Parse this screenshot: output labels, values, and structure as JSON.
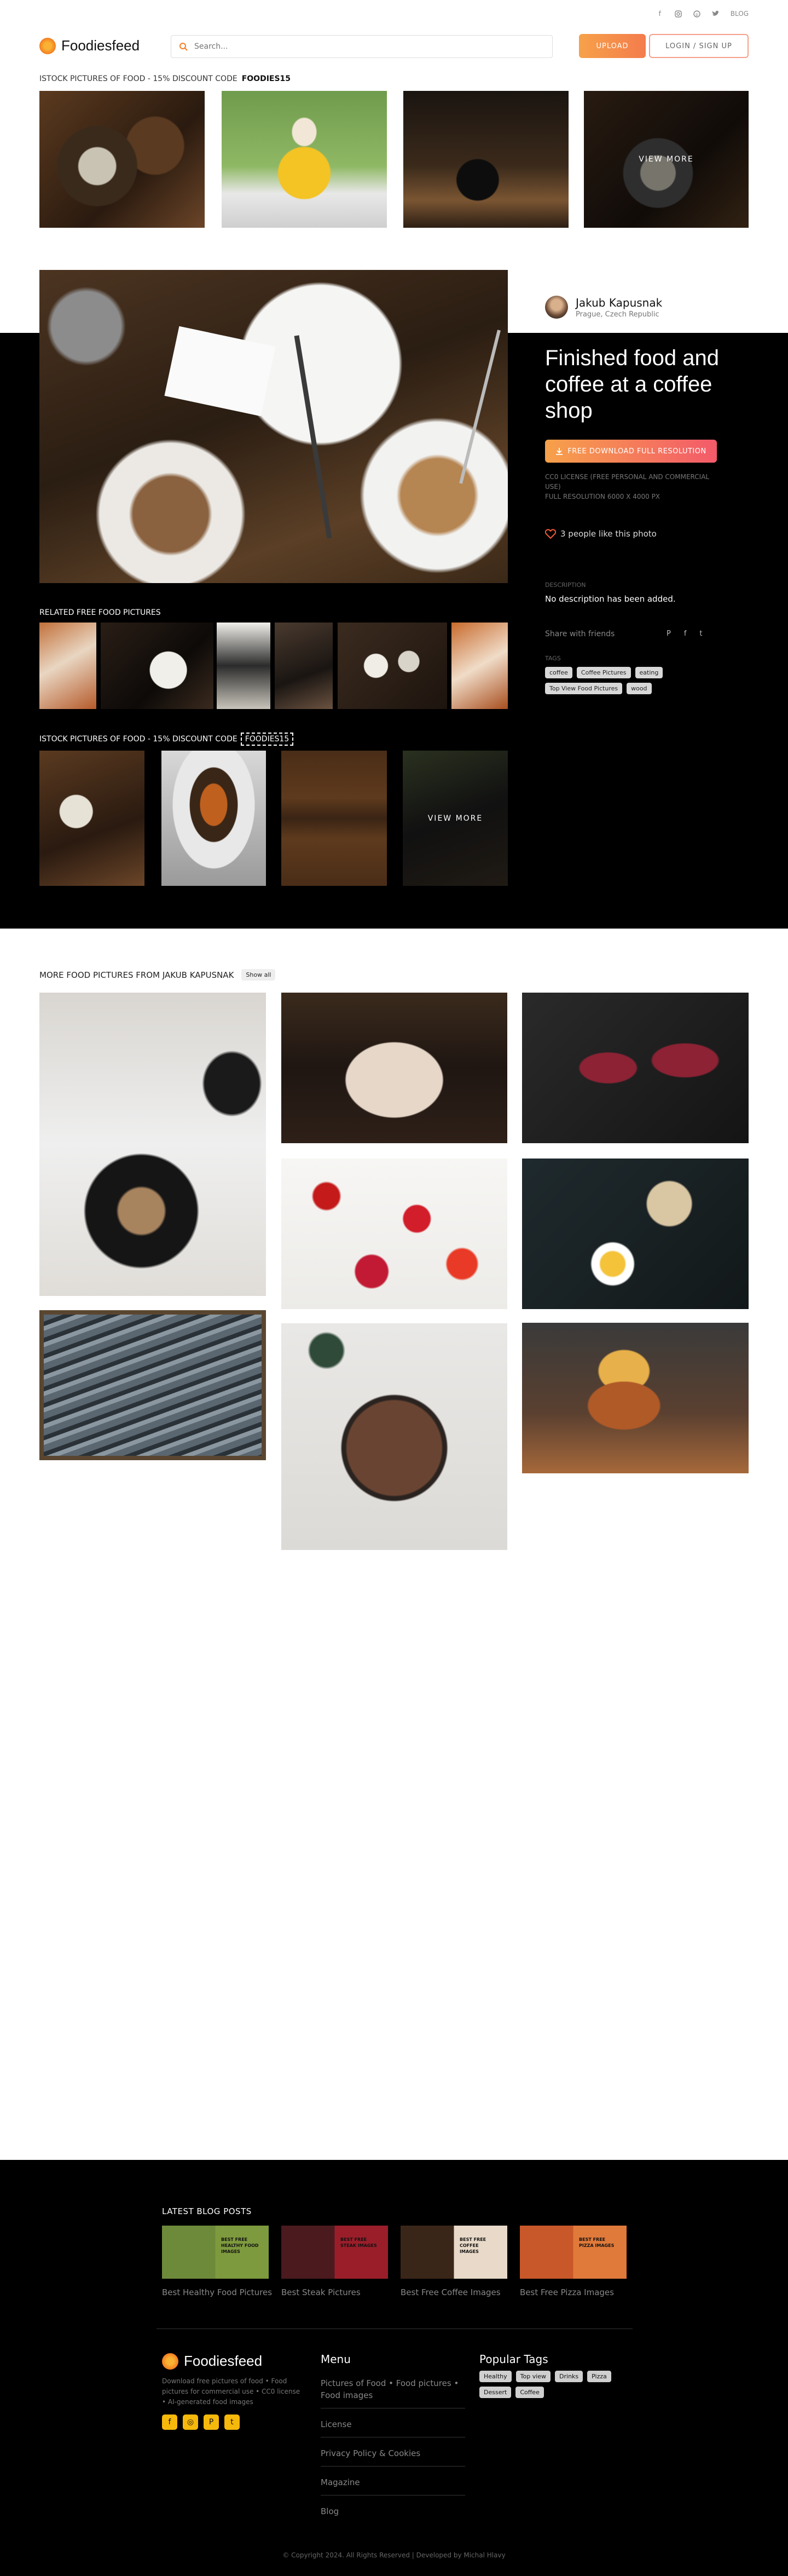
{
  "topbar": {
    "blog": "BLOG"
  },
  "header": {
    "brand": "Foodiesfeed",
    "search_placeholder": "Search...",
    "upload": "UPLOAD",
    "login": "LOGIN / SIGN UP"
  },
  "promo": {
    "text": "ISTOCK PICTURES OF FOOD - 15% DISCOUNT CODE",
    "code": "FOODIES15",
    "view_more": "VIEW MORE"
  },
  "photo": {
    "author": "Jakub Kapusnak",
    "location": "Prague, Czech Republic",
    "title": "Finished food and coffee at a coffee shop",
    "download": "FREE DOWNLOAD FULL RESOLUTION",
    "license": "CC0 LICENSE (FREE PERSONAL AND COMMERCIAL USE)",
    "resolution": "FULL RESOLUTION 6000 X 4000 PX",
    "likes": "3 people like this photo",
    "description_label": "DESCRIPTION",
    "description": "No description has been added.",
    "share": "Share with friends",
    "tags_label": "TAGS",
    "tags": [
      "coffee",
      "Coffee Pictures",
      "eating",
      "Top View Food Pictures",
      "wood"
    ]
  },
  "related": {
    "title": "RELATED FREE FOOD PICTURES"
  },
  "istock2": {
    "text": "ISTOCK PICTURES OF FOOD - 15% DISCOUNT CODE",
    "code": "FOODIES15",
    "view_more": "VIEW MORE"
  },
  "more": {
    "title": "MORE FOOD PICTURES FROM JAKUB KAPUSNAK",
    "show_all": "Show all"
  },
  "footer": {
    "blog_title": "LATEST BLOG POSTS",
    "posts": [
      {
        "caption": "Best Healthy Food Pictures",
        "badge": "BEST FREE HEALTHY FOOD IMAGES"
      },
      {
        "caption": "Best Steak Pictures",
        "badge": "BEST FREE STEAK IMAGES"
      },
      {
        "caption": "Best Free Coffee Images",
        "badge": "BEST FREE COFFEE IMAGES"
      },
      {
        "caption": "Best Free Pizza Images",
        "badge": "BEST FREE PIZZA IMAGES"
      }
    ],
    "brand": "Foodiesfeed",
    "about": "Download free pictures of food • Food pictures for commercial use • CC0 license • AI-generated food images",
    "menu_title": "Menu",
    "menu": [
      "Pictures of Food • Food pictures • Food images",
      "License",
      "Privacy Policy & Cookies",
      "Magazine",
      "Blog"
    ],
    "tags_title": "Popular Tags",
    "tags": [
      "Healthy",
      "Top view",
      "Drinks",
      "Pizza",
      "Dessert",
      "Coffee"
    ],
    "copyright": "© Copyright 2024. All Rights Reserved | Developed by Michal Hlavy"
  }
}
